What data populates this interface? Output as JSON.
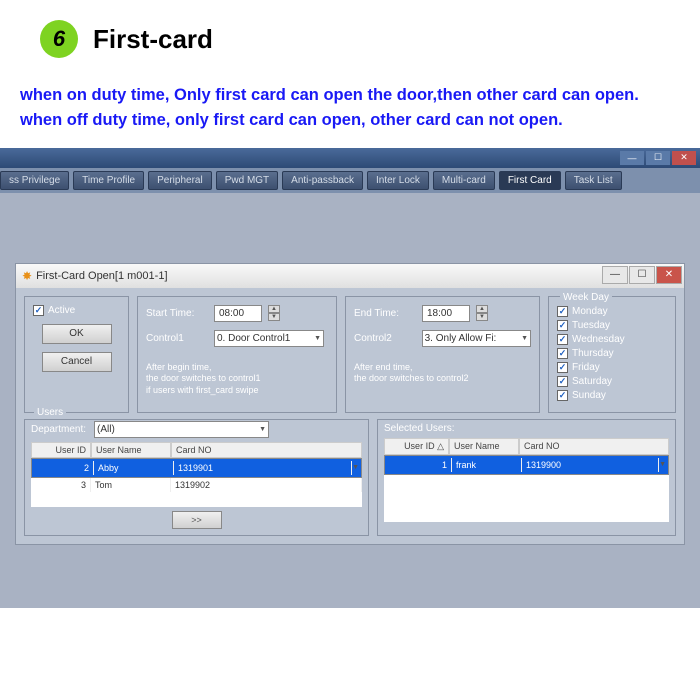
{
  "header": {
    "step_number": "6",
    "title": "First-card"
  },
  "description": "when on duty time, Only first card can open the door,then other card can open.\nwhen off duty time, only first card can open, other card can not open.",
  "tabs": [
    "ss Privilege",
    "Time Profile",
    "Peripheral",
    "Pwd MGT",
    "Anti-passback",
    "Inter Lock",
    "Multi-card",
    "First Card",
    "Task List"
  ],
  "active_tab": 7,
  "dialog": {
    "title": "First-Card Open[1   m001-1]",
    "active_label": "Active",
    "ok": "OK",
    "cancel": "Cancel",
    "start_time_label": "Start Time:",
    "start_time": "08:00",
    "control1_label": "Control1",
    "control1": "0. Door Control1",
    "note1": "After begin time,\nthe door switches to control1\nif users with first_card  swipe",
    "end_time_label": "End Time:",
    "end_time": "18:00",
    "control2_label": "Control2",
    "control2": "3. Only Allow Fi:",
    "note2": "After end time,\nthe door switches to control2",
    "weekday_title": "Week Day",
    "weekdays": [
      "Monday",
      "Tuesday",
      "Wednesday",
      "Thursday",
      "Friday",
      "Saturday",
      "Sunday"
    ],
    "users_title": "Users",
    "department_label": "Department:",
    "department": "(All)",
    "cols": [
      "User ID",
      "User Name",
      "Card NO"
    ],
    "users_left": [
      {
        "id": "2",
        "name": "Abby",
        "card": "1319901"
      },
      {
        "id": "3",
        "name": "Tom",
        "card": "1319902"
      }
    ],
    "selected_title": "Selected Users:",
    "scols": [
      "User ID  △",
      "User Name",
      "Card NO"
    ],
    "users_right": [
      {
        "id": "1",
        "name": "frank",
        "card": "1319900"
      }
    ],
    "move": ">>"
  }
}
